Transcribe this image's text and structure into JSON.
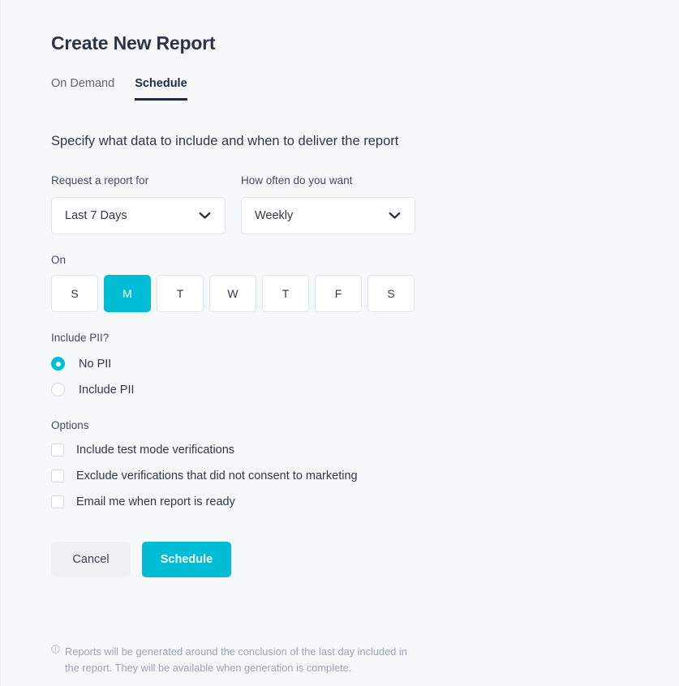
{
  "page": {
    "title": "Create New Report",
    "subtitle": "Specify what data to include and when to deliver the report"
  },
  "tabs": [
    {
      "label": "On Demand",
      "active": false
    },
    {
      "label": "Schedule",
      "active": true
    }
  ],
  "fields": {
    "range": {
      "label": "Request a report for",
      "value": "Last 7 Days",
      "icon": "chevron-down-icon"
    },
    "frequency": {
      "label": "How often do you want",
      "value": "Weekly",
      "icon": "chevron-down-icon"
    }
  },
  "days": {
    "label": "On",
    "items": [
      {
        "label": "S",
        "selected": false
      },
      {
        "label": "M",
        "selected": true
      },
      {
        "label": "T",
        "selected": false
      },
      {
        "label": "W",
        "selected": false
      },
      {
        "label": "T",
        "selected": false
      },
      {
        "label": "F",
        "selected": false
      },
      {
        "label": "S",
        "selected": false
      }
    ]
  },
  "pii": {
    "label": "Include PII?",
    "options": [
      {
        "label": "No PII",
        "selected": true
      },
      {
        "label": "Include PII",
        "selected": false
      }
    ]
  },
  "options": {
    "label": "Options",
    "items": [
      {
        "label": "Include test mode verifications",
        "checked": false
      },
      {
        "label": "Exclude verifications that did not consent to marketing",
        "checked": false
      },
      {
        "label": "Email me when report is ready",
        "checked": false
      }
    ]
  },
  "buttons": {
    "cancel": "Cancel",
    "submit": "Schedule"
  },
  "footnote": {
    "icon": "info-circle-icon",
    "text": "Reports will be generated around the conclusion of the last day included in the report. They will be available when generation is complete."
  },
  "colors": {
    "accent": "#00bcd4",
    "tab_active": "#1f2a44",
    "text": "#2e3748",
    "muted": "#9aa3b2",
    "background": "#f7f8fa"
  }
}
